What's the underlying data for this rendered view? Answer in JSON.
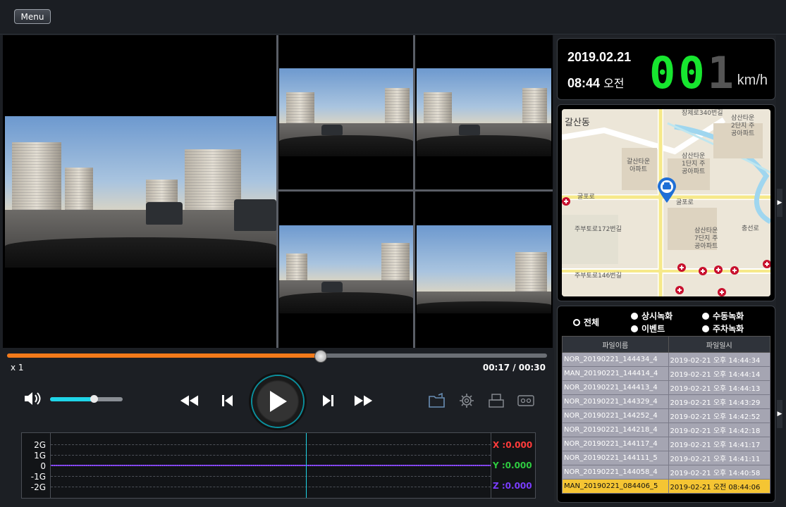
{
  "menu": {
    "label": "Menu"
  },
  "player": {
    "speed": "x 1",
    "time_current": "00:17",
    "time_total": "00:30",
    "time_display": "00:17 / 00:30",
    "progress_fraction": 0.58,
    "volume_fraction": 0.6
  },
  "gsensor": {
    "labels": [
      "2G",
      "1G",
      "0",
      "-1G",
      "-2G"
    ],
    "x": "X :0.000",
    "y": "Y :0.000",
    "z": "Z :0.000",
    "colors": {
      "x": "#ff3b3b",
      "y": "#2ecc40",
      "z": "#7a3cff"
    }
  },
  "dashboard": {
    "date": "2019.02.21",
    "time": "08:44",
    "ampm": "오전",
    "speed": "001",
    "unit": "km/h"
  },
  "map": {
    "labels": {
      "area": "갈산동",
      "road1": "굴포로",
      "road2": "굴포로",
      "apt1": "갈산타운\n아파트",
      "apt2": "삼산타운\n1단지 주\n공아파트",
      "apt3": "삼산타운\n2단지 주\n공아파트",
      "apt4": "삼산타운\n7단지 주\n공아파트",
      "street1": "주부토로172번길",
      "street2": "주부토로146번길",
      "top": "장제로340번길",
      "side": "충선로"
    }
  },
  "filter": {
    "all": "전체",
    "normal": "상시녹화",
    "manual": "수동녹화",
    "event": "이벤트",
    "parking": "주차녹화"
  },
  "files": {
    "headers": [
      "파일이름",
      "파일일시"
    ],
    "rows": [
      [
        "NOR_20190221_144434_4",
        "2019-02-21 오후 14:44:34"
      ],
      [
        "MAN_20190221_144414_4",
        "2019-02-21 오후 14:44:14"
      ],
      [
        "NOR_20190221_144413_4",
        "2019-02-21 오후 14:44:13"
      ],
      [
        "NOR_20190221_144329_4",
        "2019-02-21 오후 14:43:29"
      ],
      [
        "NOR_20190221_144252_4",
        "2019-02-21 오후 14:42:52"
      ],
      [
        "NOR_20190221_144218_4",
        "2019-02-21 오후 14:42:18"
      ],
      [
        "NOR_20190221_144117_4",
        "2019-02-21 오후 14:41:17"
      ],
      [
        "NOR_20190221_144111_5",
        "2019-02-21 오후 14:41:11"
      ],
      [
        "NOR_20190221_144058_4",
        "2019-02-21 오후 14:40:58"
      ],
      [
        "MAN_20190221_084406_5",
        "2019-02-21 오전 08:44:06"
      ]
    ],
    "selected_index": 9
  }
}
